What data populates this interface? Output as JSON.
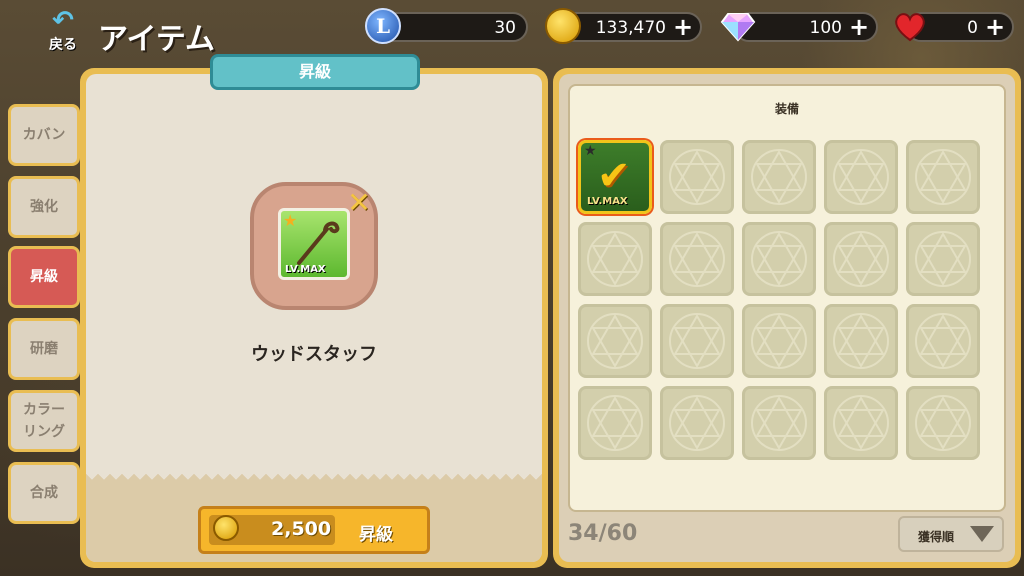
{
  "header": {
    "back_label": "戻る",
    "title": "アイテム"
  },
  "currencies": {
    "level": "30",
    "gold": "133,470",
    "gems": "100",
    "hearts": "0"
  },
  "tabs": [
    {
      "label": "カバン"
    },
    {
      "label": "強化"
    },
    {
      "label": "昇級",
      "active": true
    },
    {
      "label": "研磨"
    },
    {
      "label": "カラーリング"
    },
    {
      "label": "合成"
    }
  ],
  "left_panel": {
    "tag": "昇級",
    "item_level": "LV.MAX",
    "item_name": "ウッドスタッフ",
    "cost": "2,500",
    "action_label": "昇級"
  },
  "right_panel": {
    "header": "装備",
    "selected_level": "LV.MAX",
    "count": "34/60",
    "sort_label": "獲得順"
  },
  "colors": {
    "panel_border": "#e9bd52",
    "active_tab": "#d65a55",
    "teal_tag": "#62c1c8",
    "upgrade_button": "#f6b62b"
  }
}
